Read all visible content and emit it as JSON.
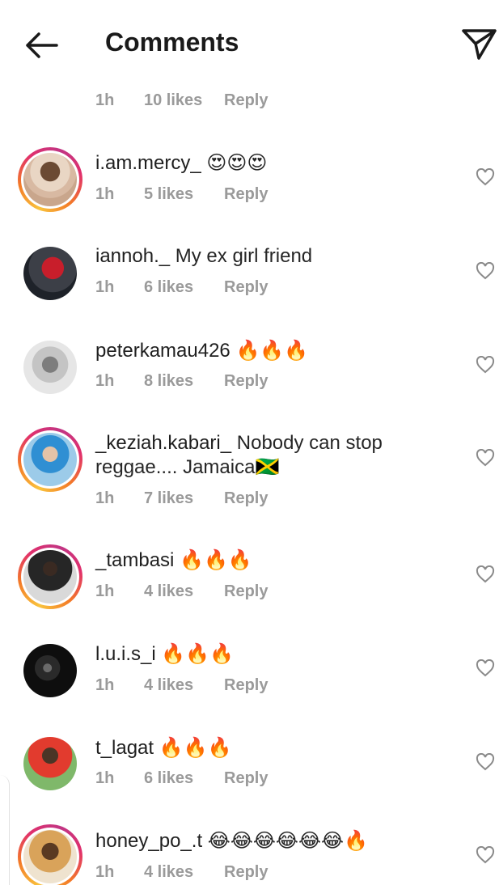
{
  "header": {
    "title": "Comments",
    "back_icon": "arrow-left-icon",
    "send_icon": "paper-plane-icon"
  },
  "top_meta": {
    "time": "1h",
    "likes": "10 likes",
    "reply": "Reply"
  },
  "comments": [
    {
      "user": "i.am.mercy_",
      "text": "😍😍😍",
      "time": "1h",
      "likes": "5 likes",
      "reply": "Reply",
      "story_ring": true
    },
    {
      "user": "iannoh._",
      "text": "My ex girl friend",
      "time": "1h",
      "likes": "6 likes",
      "reply": "Reply",
      "story_ring": false
    },
    {
      "user": "peterkamau426",
      "text": "🔥🔥🔥",
      "time": "1h",
      "likes": "8 likes",
      "reply": "Reply",
      "story_ring": false
    },
    {
      "user": "_keziah.kabari_",
      "text": "Nobody can stop reggae.... Jamaica🇯🇲",
      "time": "1h",
      "likes": "7 likes",
      "reply": "Reply",
      "story_ring": true
    },
    {
      "user": "_tambasi",
      "text": "🔥🔥🔥",
      "time": "1h",
      "likes": "4 likes",
      "reply": "Reply",
      "story_ring": true
    },
    {
      "user": "l.u.i.s_i",
      "text": "🔥🔥🔥",
      "time": "1h",
      "likes": "4 likes",
      "reply": "Reply",
      "story_ring": false
    },
    {
      "user": "t_lagat",
      "text": "🔥🔥🔥",
      "time": "1h",
      "likes": "6 likes",
      "reply": "Reply",
      "story_ring": false
    },
    {
      "user": "honey_po_.t",
      "text": "😂😂😂😂😂😂🔥",
      "time": "1h",
      "likes": "4 likes",
      "reply": "Reply",
      "story_ring": true
    }
  ],
  "colors": {
    "accent_ring_start": "#f9c33d",
    "accent_ring_end": "#c13584",
    "meta_gray": "#9a9a9a",
    "text": "#262626"
  }
}
